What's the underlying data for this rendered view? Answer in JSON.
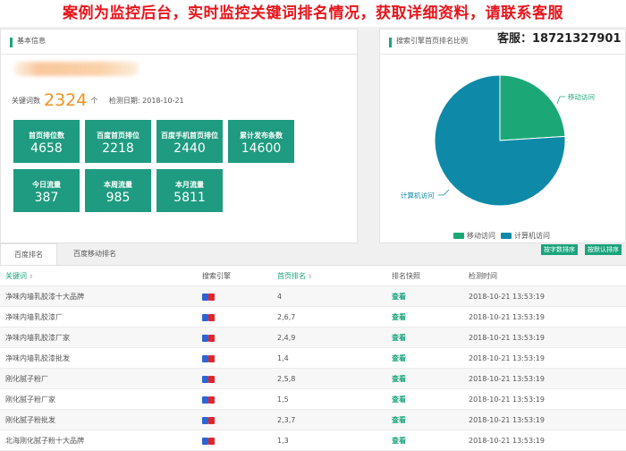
{
  "banner": {
    "text": "案例为监控后台，实时监控关键词排名情况，获取详细资料，请联系客服"
  },
  "basic_info": {
    "title": "基本信息",
    "keyword_count_label": "关键词数",
    "keyword_count": "2324",
    "keyword_unit": "个",
    "check_date_label": "检测日期:",
    "check_date": "2018-10-21"
  },
  "tiles": [
    {
      "label": "首页排位数",
      "value": "4658"
    },
    {
      "label": "百度首页排位",
      "value": "2218"
    },
    {
      "label": "百度手机首页排位",
      "value": "2440"
    },
    {
      "label": "累计发布条数",
      "value": "14600"
    },
    {
      "label": "今日流量",
      "value": "387"
    },
    {
      "label": "本周流量",
      "value": "985"
    },
    {
      "label": "本月流量",
      "value": "5811"
    }
  ],
  "service": {
    "text": "客服：18721327901"
  },
  "pie_panel": {
    "title": "搜索引擎首页排名比例",
    "labels": [
      "移动访问",
      "计算机访问"
    ],
    "legend": [
      "移动访问",
      "计算机访问"
    ]
  },
  "chart_data": {
    "type": "pie",
    "title": "",
    "categories": [
      "移动访问",
      "计算机访问"
    ],
    "values": [
      24,
      76
    ],
    "colors": [
      "#1ba876",
      "#0e8aa8"
    ],
    "legend_position": "bottom"
  },
  "tabs": [
    "百度排名",
    "百度移动排名"
  ],
  "buttons": {
    "sort_by_count": "按字数排序",
    "sort_default": "按默认排序"
  },
  "table": {
    "headers": [
      "关键词",
      "搜索引擎",
      "首页排名",
      "排名快照",
      "检测时间"
    ],
    "rows": [
      {
        "keyword": "净味内墙乳胶漆十大品牌",
        "rank": "4",
        "snapshot": "查看",
        "time": "2018-10-21 13:53:19"
      },
      {
        "keyword": "净味内墙乳胶漆厂",
        "rank": "2,6,7",
        "snapshot": "查看",
        "time": "2018-10-21 13:53:19"
      },
      {
        "keyword": "净味内墙乳胶漆厂家",
        "rank": "2,4,9",
        "snapshot": "查看",
        "time": "2018-10-21 13:53:19"
      },
      {
        "keyword": "净味内墙乳胶漆批发",
        "rank": "1,4",
        "snapshot": "查看",
        "time": "2018-10-21 13:53:19"
      },
      {
        "keyword": "刚化腻子粉厂",
        "rank": "2,5,8",
        "snapshot": "查看",
        "time": "2018-10-21 13:53:19"
      },
      {
        "keyword": "刚化腻子粉厂家",
        "rank": "1,5",
        "snapshot": "查看",
        "time": "2018-10-21 13:53:19"
      },
      {
        "keyword": "刚化腻子粉批发",
        "rank": "2,3,7",
        "snapshot": "查看",
        "time": "2018-10-21 13:53:19"
      },
      {
        "keyword": "北海刚化腻子粉十大品牌",
        "rank": "1,3",
        "snapshot": "查看",
        "time": "2018-10-21 13:53:19"
      }
    ]
  }
}
